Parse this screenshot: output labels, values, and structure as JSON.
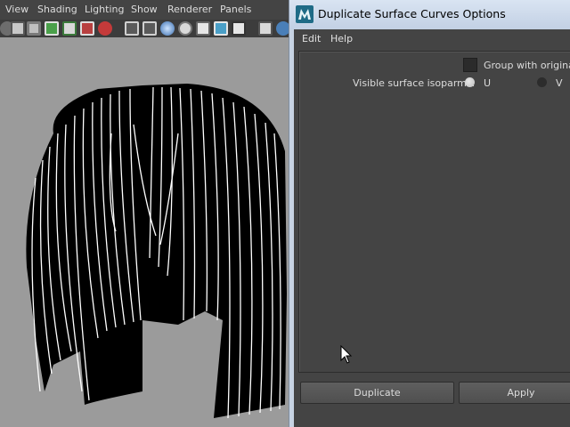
{
  "maya": {
    "menu": [
      "View",
      "Shading",
      "Lighting",
      "Show",
      "Renderer",
      "Panels"
    ]
  },
  "dialog": {
    "title": "Duplicate Surface Curves Options",
    "menu": [
      "Edit",
      "Help"
    ],
    "group_with_original": {
      "label": "Group with original",
      "checked": false
    },
    "isoparms": {
      "label": "Visible surface isoparms:",
      "u_label": "U",
      "u_selected": true,
      "v_label": "V",
      "v_selected": false
    },
    "buttons": {
      "duplicate": "Duplicate",
      "apply": "Apply"
    }
  },
  "colors": {
    "panel_bg": "#444444",
    "title_bar": "#c7d3e3",
    "viewport_bg": "#9b9b9b"
  }
}
